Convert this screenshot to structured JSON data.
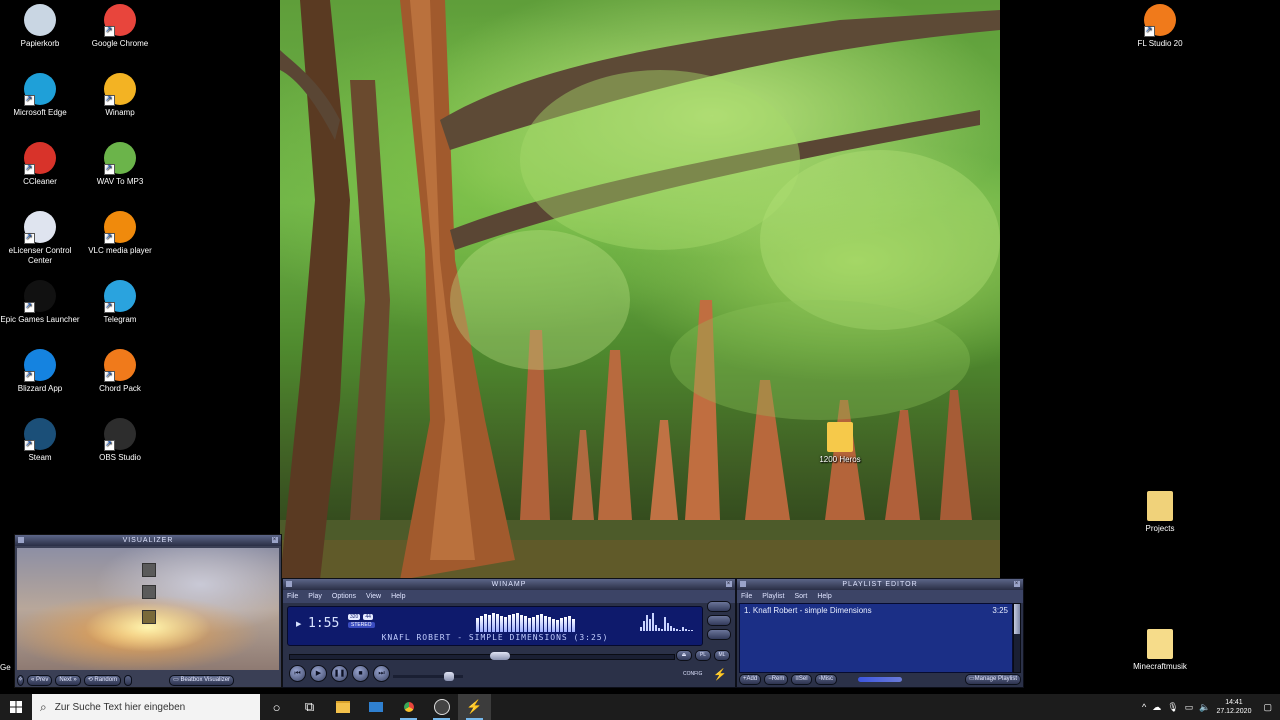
{
  "desktop": {
    "left_icons": [
      {
        "label": "Papierkorb",
        "icon": "recycle-bin-icon",
        "color": "#c9d6e3"
      },
      {
        "label": "Google Chrome",
        "icon": "chrome-icon",
        "color": "#e8453c"
      },
      {
        "label": "Microsoft Edge",
        "icon": "edge-icon",
        "color": "#1fa0d8"
      },
      {
        "label": "Winamp",
        "icon": "winamp-icon",
        "color": "#f3b323"
      },
      {
        "label": "CCleaner",
        "icon": "ccleaner-icon",
        "color": "#d8332a"
      },
      {
        "label": "WAV To MP3",
        "icon": "wav-to-mp3-icon",
        "color": "#6bb44a"
      },
      {
        "label": "eLicenser Control Center",
        "icon": "elicenser-icon",
        "color": "#dfe4ef"
      },
      {
        "label": "VLC media player",
        "icon": "vlc-icon",
        "color": "#f08a0c"
      },
      {
        "label": "Epic Games Launcher",
        "icon": "epic-games-icon",
        "color": "#111111"
      },
      {
        "label": "Telegram",
        "icon": "telegram-icon",
        "color": "#2aa3de"
      },
      {
        "label": "Blizzard App",
        "icon": "blizzard-icon",
        "color": "#1583e0"
      },
      {
        "label": "Chord Pack",
        "icon": "chord-pack-icon",
        "color": "#f07a1b"
      },
      {
        "label": "Steam",
        "icon": "steam-icon",
        "color": "#1b4f78"
      },
      {
        "label": "OBS Studio",
        "icon": "obs-icon",
        "color": "#2d2d2d"
      }
    ],
    "right_icons": [
      {
        "label": "FL Studio 20",
        "icon": "fl-studio-icon",
        "color": "#f07a1b"
      },
      {
        "label": "1200 Heros",
        "icon": "folder-icon",
        "color": "#f6c94a"
      },
      {
        "label": "Projects",
        "icon": "folder-icon",
        "color": "#f0d27a"
      },
      {
        "label": "Minecraftmusik",
        "icon": "folder-icon",
        "color": "#f6dc8a"
      }
    ],
    "partial_label": "Ge"
  },
  "visualizer": {
    "title": "VISUALIZER",
    "buttons": [
      "Prev",
      "Next",
      "Random",
      "Beatbox Visualizer"
    ]
  },
  "winamp": {
    "title": "WINAMP",
    "menu": [
      "File",
      "Play",
      "Options",
      "View",
      "Help"
    ],
    "time": "1:55",
    "kbps": "320",
    "khz": "44",
    "stereo": "STEREO",
    "track_scroll": "KNAFL ROBERT - SIMPLE DIMENSIONS (3:25)",
    "config_label": "CONFIG",
    "seek_position": 0.55,
    "volume_level": 0.85
  },
  "playlist": {
    "title": "PLAYLIST EDITOR",
    "menu": [
      "File",
      "Playlist",
      "Sort",
      "Help"
    ],
    "items": [
      {
        "title": "1. Knafl Robert - simple Dimensions",
        "duration": "3:25"
      }
    ],
    "buttons": [
      "Add",
      "Rem",
      "Sel",
      "Misc",
      "Manage Playlist"
    ]
  },
  "taskbar": {
    "search_placeholder": "Zur Suche Text hier eingeben",
    "time": "14:41",
    "date": "27.12.2020"
  }
}
